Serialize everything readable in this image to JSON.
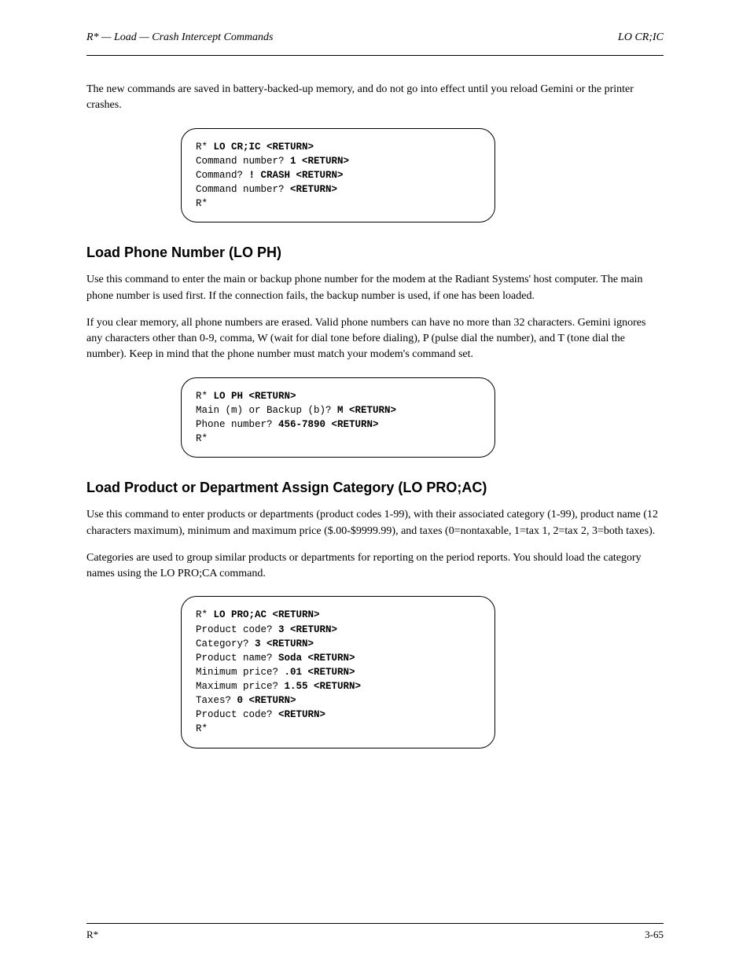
{
  "header": {
    "left": "R* — Load — Crash Intercept Commands",
    "right": "LO CR;IC"
  },
  "footer": {
    "left": "R*",
    "right": "3-65"
  },
  "intro_para": "The new commands are saved in battery-backed-up memory, and do not go into effect until you reload Gemini or the printer crashes.",
  "term1": {
    "l1_pre": "R* ",
    "l1_bold": "LO CR;IC <RETURN>",
    "l2_pre": "Command number? ",
    "l2_bold": "1 <RETURN>",
    "l3_pre": "Command? ",
    "l3_bold": "! CRASH <RETURN>",
    "l4_pre": "Command number? ",
    "l4_bold": "<RETURN>",
    "l5": "R*"
  },
  "section_phone": {
    "heading": "Load Phone Number (LO PH)",
    "p1": "Use this command to enter the main or backup phone number for the modem at the Radiant Systems' host computer. The main phone number is used first. If the connection fails, the backup number is used, if one has been loaded.",
    "p2": "If you clear memory, all phone numbers are erased. Valid phone numbers can have no more than 32 characters. Gemini ignores any characters other than 0-9, comma, W (wait for dial tone before dialing), P (pulse dial the number), and T (tone dial the number). Keep in mind that the phone number must match your modem's command set."
  },
  "term2": {
    "l1_pre": "R* ",
    "l1_bold": "LO PH <RETURN>",
    "l2_pre": "Main (m) or Backup (b)? ",
    "l2_bold": "M <RETURN>",
    "l3_pre": "Phone number? ",
    "l3_bold": "456-7890 <RETURN>",
    "l4": "R*"
  },
  "section_product": {
    "heading": "Load Product or Department Assign Category (LO PRO;AC)",
    "p1": "Use this command to enter products or departments (product codes 1-99), with their associated category (1-99), product name (12 characters maximum), minimum and maximum price ($.00-$9999.99), and taxes (0=nontaxable, 1=tax 1, 2=tax 2, 3=both taxes).",
    "p2": "Categories are used to group similar products or departments for reporting on the period reports. You should load the category names using the LO PRO;CA command."
  },
  "term3": {
    "l1_pre": "R* ",
    "l1_bold": "LO PRO;AC <RETURN>",
    "l2_pre": "Product code? ",
    "l2_bold": "3 <RETURN>",
    "l3_pre": "Category? ",
    "l3_bold": "3 <RETURN>",
    "l4_pre": "Product name? ",
    "l4_bold": "Soda <RETURN>",
    "l5_pre": "Minimum price? ",
    "l5_bold": ".01 <RETURN>",
    "l6_pre": "Maximum price? ",
    "l6_bold": "1.55 <RETURN>",
    "l7_pre": "Taxes? ",
    "l7_bold": "0 <RETURN>",
    "l8_pre": "Product code? ",
    "l8_bold": "<RETURN>",
    "l9": "R*"
  }
}
